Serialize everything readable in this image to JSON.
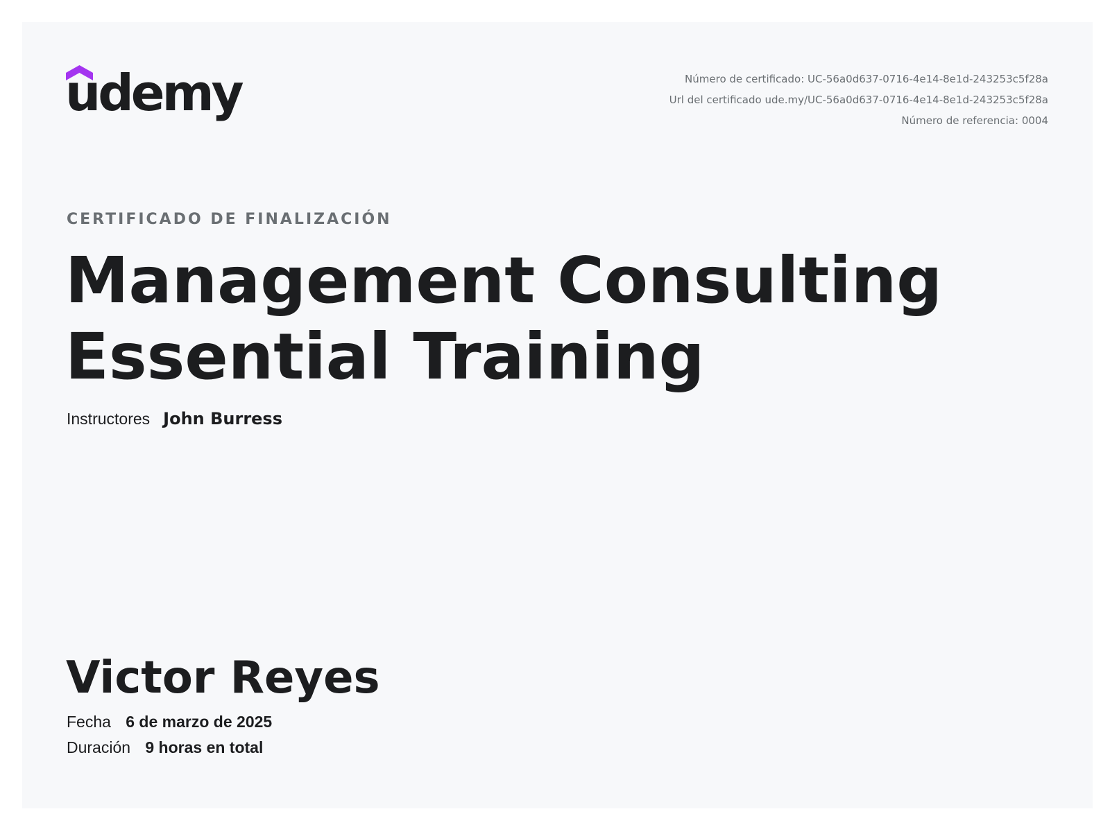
{
  "brand": {
    "name": "udemy",
    "accent_color": "#a435f0",
    "logo_icon": "graduation-cap-icon"
  },
  "meta": {
    "certificate_number": "Número de certificado: UC-56a0d637-0716-4e14-8e1d-243253c5f28a",
    "certificate_url": "Url del certificado ude.my/UC-56a0d637-0716-4e14-8e1d-243253c5f28a",
    "reference_number": "Número de referencia: 0004"
  },
  "certificate": {
    "heading": "CERTIFICADO DE FINALIZACIÓN",
    "course_title": "Management Consulting Essential Training",
    "instructors_label": "Instructores",
    "instructor_name": "John Burress",
    "recipient_name": "Victor Reyes",
    "date_label": "Fecha",
    "date_value": "6 de marzo de 2025",
    "duration_label": "Duración",
    "duration_value": "9 horas en total"
  }
}
